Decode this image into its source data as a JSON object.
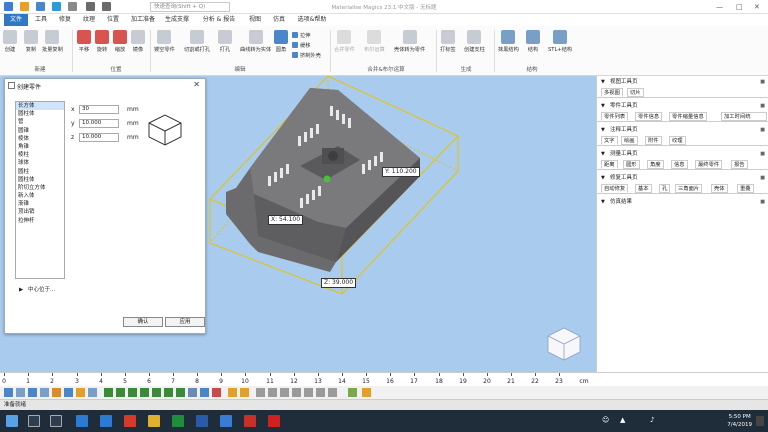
{
  "window": {
    "title": "Materialise Magics 23.1 中文版 - 无标题",
    "search_placeholder": "快速查询(Shift + Q)"
  },
  "menus": [
    "文件",
    "工具",
    "修复",
    "纹理",
    "位置",
    "加工准备",
    "生成支撑",
    "分析 & 报告",
    "视图",
    "仿真",
    "选项&帮助"
  ],
  "ribbon": {
    "buttons": [
      {
        "label": "创建",
        "icon": "cube-icon",
        "group": "新建"
      },
      {
        "label": "复制",
        "icon": "copy-icon",
        "group": "新建"
      },
      {
        "label": "批量复制",
        "icon": "batch-copy-icon",
        "group": "新建"
      },
      {
        "label": "平移",
        "icon": "translate-icon",
        "group": "位置"
      },
      {
        "label": "旋转",
        "icon": "rotate-icon",
        "group": "位置"
      },
      {
        "label": "缩放",
        "icon": "scale-icon",
        "group": "位置"
      },
      {
        "label": "镜像",
        "icon": "mirror-icon",
        "group": "位置"
      },
      {
        "label": "镂空零件",
        "icon": "hollow-icon",
        "group": "编辑"
      },
      {
        "label": "切割或打孔",
        "icon": "cut-icon",
        "group": "编辑"
      },
      {
        "label": "打孔",
        "icon": "punch-icon",
        "group": "编辑"
      },
      {
        "label": "曲线转为实体",
        "icon": "curve-solid-icon",
        "group": "编辑"
      },
      {
        "label": "圆角",
        "icon": "fillet-icon",
        "group": "编辑"
      },
      {
        "label": "合并零件",
        "icon": "merge-icon",
        "group": "合并&布尔运算",
        "disabled": true
      },
      {
        "label": "布尔运算",
        "icon": "boolean-icon",
        "group": "合并&布尔运算",
        "disabled": true
      },
      {
        "label": "壳体转为零件",
        "icon": "shell-icon",
        "group": "合并&布尔运算"
      },
      {
        "label": "打标签",
        "icon": "label-icon",
        "group": "生成"
      },
      {
        "label": "创建支柱",
        "icon": "pillar-icon",
        "group": "生成"
      },
      {
        "label": "抹黑结构",
        "icon": "lattice-icon",
        "group": "结构"
      },
      {
        "label": "结构",
        "icon": "structure-icon",
        "group": "结构"
      },
      {
        "label": "STL+结构",
        "icon": "stl-structure-icon",
        "group": "结构"
      }
    ],
    "small_buttons": [
      "拉伸",
      "缓移",
      "挤制外壳"
    ],
    "groups": [
      "新建",
      "位置",
      "编辑",
      "合并&布尔运算",
      "生成",
      "结构"
    ]
  },
  "dialog": {
    "title": "创建零件",
    "shapes": [
      "长方体",
      "圆柱体",
      "管",
      "圆锥",
      "棱体",
      "角锥",
      "棱柱",
      "球体",
      "圆柱",
      "圆柱体",
      "阶切立方体",
      "新入体",
      "渐锥",
      "顶出销",
      "拉伸杆"
    ],
    "selected_index": 0,
    "fields": [
      {
        "axis": "x",
        "value": "30",
        "unit": "mm"
      },
      {
        "axis": "y",
        "value": "10.000",
        "unit": "mm"
      },
      {
        "axis": "z",
        "value": "10.000",
        "unit": "mm"
      }
    ],
    "center_label": "中心位于...",
    "ok_label": "确认",
    "apply_label": "应用"
  },
  "viewport": {
    "dim_x": "X: 54.100",
    "dim_y": "Y: 110.200",
    "dim_z": "Z: 39.000"
  },
  "right_panel": {
    "sections": [
      {
        "title": "视图工具页",
        "tabs": [
          "多视图",
          "切片"
        ]
      },
      {
        "title": "零件工具页",
        "tabs": [
          "零件列表",
          "零件信息",
          "零件缩量信息",
          "加工时间统"
        ]
      },
      {
        "title": "注释工具页",
        "tabs": [
          "文字",
          "绘画",
          "附件",
          "纹理"
        ]
      },
      {
        "title": "测量工具页",
        "tabs": [
          "距离",
          "圆形",
          "角度",
          "信息",
          "最终零件",
          "报告"
        ]
      },
      {
        "title": "修复工具页",
        "tabs": [
          "自动修复",
          "基本",
          "孔",
          "三角面片",
          "壳体",
          "重叠"
        ]
      },
      {
        "title": "仿真结果",
        "tabs": []
      }
    ]
  },
  "ruler": {
    "ticks": [
      "0",
      "1",
      "2",
      "3",
      "4",
      "5",
      "6",
      "7",
      "8",
      "9",
      "10",
      "11",
      "12",
      "13",
      "14",
      "15",
      "16",
      "17",
      "18",
      "19",
      "20",
      "21",
      "22",
      "23"
    ],
    "unit": "cm"
  },
  "status_text": "准备就绪",
  "taskbar": {
    "time": "5:50 PM",
    "date": "7/4/2019"
  },
  "colors": {
    "accent": "#2f78c3",
    "viewport": "#a9cbee",
    "bbox": "#e6c200",
    "part": "#6e6e70"
  }
}
